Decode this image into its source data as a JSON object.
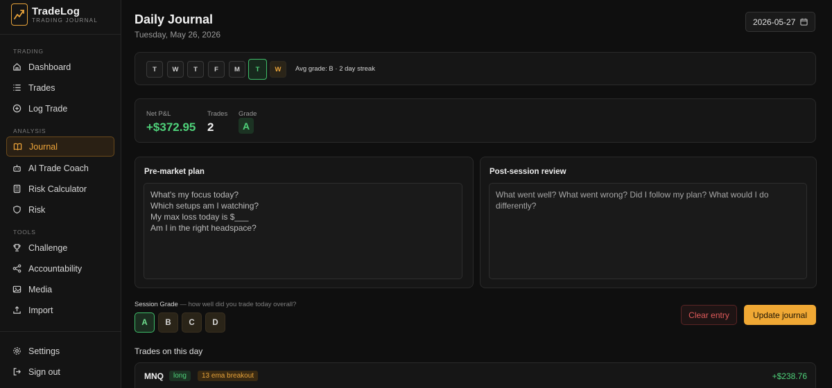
{
  "brand": {
    "name": "TradeLog",
    "subtitle": "TRADING JOURNAL"
  },
  "sidebar": {
    "sections": {
      "trading": "TRADING",
      "analysis": "ANALYSIS",
      "tools": "TOOLS"
    },
    "items": [
      {
        "label": "Dashboard",
        "icon": "home-icon"
      },
      {
        "label": "Trades",
        "icon": "list-icon"
      },
      {
        "label": "Log Trade",
        "icon": "plus-circle-icon"
      },
      {
        "label": "Journal",
        "icon": "book-icon",
        "active": true
      },
      {
        "label": "AI Trade Coach",
        "icon": "robot-icon"
      },
      {
        "label": "Risk Calculator",
        "icon": "calculator-icon"
      },
      {
        "label": "Risk",
        "icon": "shield-icon"
      },
      {
        "label": "Challenge",
        "icon": "trophy-icon"
      },
      {
        "label": "Accountability",
        "icon": "share-icon"
      },
      {
        "label": "Media",
        "icon": "image-icon"
      },
      {
        "label": "Import",
        "icon": "upload-icon"
      },
      {
        "label": "Settings",
        "icon": "gear-icon"
      },
      {
        "label": "Sign out",
        "icon": "logout-icon"
      }
    ]
  },
  "header": {
    "title": "Daily Journal",
    "subtitle": "Tuesday, May 26, 2026",
    "date_value": "2026-05-27"
  },
  "week": {
    "days": [
      "T",
      "W",
      "T",
      "F",
      "M",
      "T",
      "W"
    ],
    "meta": "Avg grade: B · 2 day streak"
  },
  "stats": {
    "net_pnl_label": "Net P&L",
    "net_pnl_value": "+$372.95",
    "trades_label": "Trades",
    "trades_value": "2",
    "grade_label": "Grade",
    "grade_value": "A"
  },
  "premarket": {
    "title": "Pre-market plan",
    "text": "What's my focus today?\nWhich setups am I watching?\nMy max loss today is $___\nAm I in the right headspace?"
  },
  "postsession": {
    "title": "Post-session review",
    "placeholder": "What went well? What went wrong? Did I follow my plan? What would I do differently?"
  },
  "session_grade": {
    "label": "Session Grade",
    "hint": "— how well did you trade today overall?",
    "options": [
      "A",
      "B",
      "C",
      "D"
    ],
    "selected": "A"
  },
  "actions": {
    "clear": "Clear entry",
    "update": "Update journal"
  },
  "trades": {
    "heading": "Trades on this day",
    "rows": [
      {
        "symbol": "MNQ",
        "side": "long",
        "setup": "13 ema breakout",
        "pnl": "+$238.76"
      }
    ]
  },
  "colors": {
    "accent": "#f0a834",
    "positive": "#4fd27a",
    "negative": "#e05a5a"
  }
}
